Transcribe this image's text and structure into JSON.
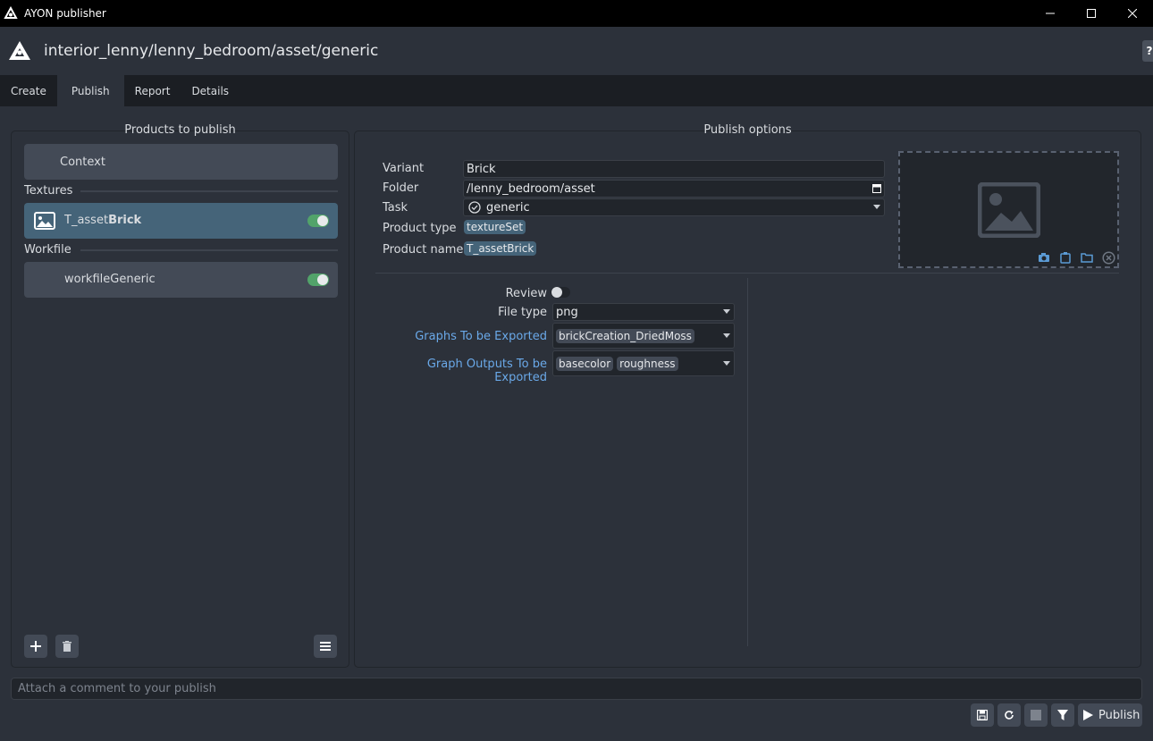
{
  "window": {
    "title": "AYON publisher",
    "controls": [
      "minimize-icon",
      "maximize-icon",
      "close-icon"
    ]
  },
  "header": {
    "context_path": "interior_lenny/lenny_bedroom/asset/generic",
    "help_label": "?"
  },
  "tabs": [
    {
      "label": "Create",
      "active": false
    },
    {
      "label": "Publish",
      "active": true
    },
    {
      "label": "Report",
      "active": false
    },
    {
      "label": "Details",
      "active": false
    }
  ],
  "products_panel": {
    "title": "Products to publish",
    "context_item": "Context",
    "groups": [
      {
        "label": "Textures",
        "items": [
          {
            "prefix": "T_asset",
            "bold": "Brick",
            "enabled": true,
            "selected": true,
            "icon": "image-icon"
          }
        ]
      },
      {
        "label": "Workfile",
        "items": [
          {
            "prefix": "workfileGeneric",
            "bold": "",
            "enabled": true,
            "selected": false
          }
        ]
      }
    ],
    "tools": [
      "plus-icon",
      "trash-icon",
      "menu-icon"
    ]
  },
  "options_panel": {
    "title": "Publish options",
    "fields": {
      "variant_label": "Variant",
      "variant_value": "Brick",
      "folder_label": "Folder",
      "folder_value": "/lenny_bedroom/asset",
      "task_label": "Task",
      "task_value": "generic",
      "product_type_label": "Product type",
      "product_type_value": "textureSet",
      "product_name_label": "Product name",
      "product_name_value": "T_assetBrick"
    },
    "thumbnail_tools": [
      "camera-icon",
      "paste-icon",
      "folder-icon",
      "clear-icon"
    ],
    "plugin_options": {
      "review_label": "Review",
      "review_enabled": false,
      "file_type_label": "File type",
      "file_type_value": "png",
      "graphs_label": "Graphs To be Exported",
      "graphs_values": [
        "brickCreation_DriedMoss"
      ],
      "outputs_label": "Graph Outputs To be Exported",
      "outputs_values": [
        "basecolor",
        "roughness"
      ]
    }
  },
  "comment": {
    "placeholder": "Attach a comment to your publish"
  },
  "footer": {
    "publish_label": "Publish",
    "tools": [
      "save-icon",
      "refresh-icon",
      "stop-icon",
      "filter-icon",
      "play-icon"
    ]
  },
  "colors": {
    "background": "#2c313a",
    "selected": "#456479",
    "toggle_on": "#52a36a",
    "link_blue": "#6aa9e9"
  }
}
